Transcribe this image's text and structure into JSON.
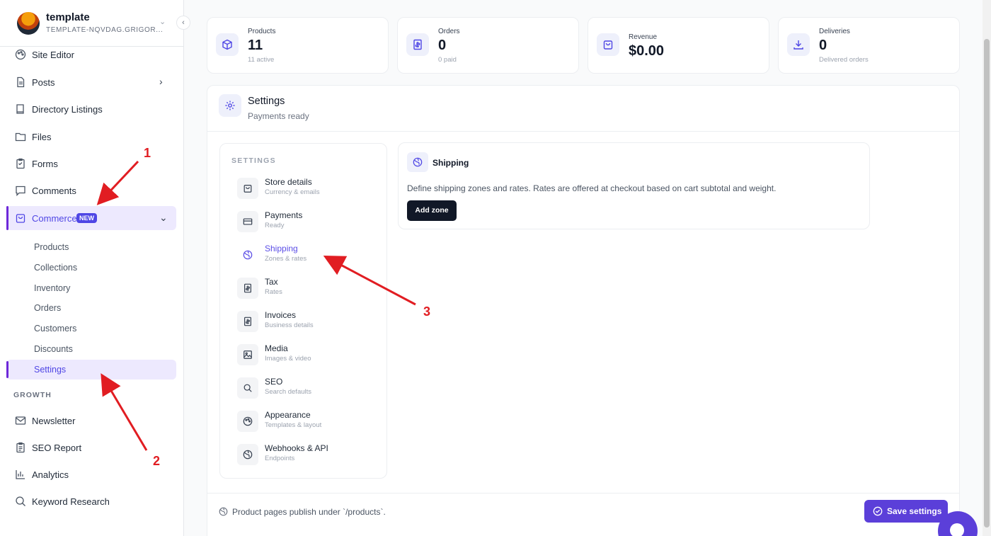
{
  "workspace": {
    "name": "template",
    "subtitle": "TEMPLATE-NQVDAG.GRIGOR..."
  },
  "sidebar": {
    "items": [
      {
        "label": "Site Editor",
        "icon": "palette-icon"
      },
      {
        "label": "Posts",
        "icon": "document-icon"
      },
      {
        "label": "Directory Listings",
        "icon": "book-icon"
      },
      {
        "label": "Files",
        "icon": "folder-icon"
      },
      {
        "label": "Forms",
        "icon": "clipboard-icon"
      },
      {
        "label": "Comments",
        "icon": "comment-icon"
      },
      {
        "label": "Commerce",
        "icon": "shopping-bag-icon",
        "badge": "NEW"
      }
    ],
    "commerce_sub": [
      "Products",
      "Collections",
      "Inventory",
      "Orders",
      "Customers",
      "Discounts",
      "Settings"
    ],
    "growth_label": "GROWTH",
    "growth_items": [
      {
        "label": "Newsletter",
        "icon": "mail-icon"
      },
      {
        "label": "SEO Report",
        "icon": "clipboard-check-icon"
      },
      {
        "label": "Analytics",
        "icon": "bar-chart-icon"
      },
      {
        "label": "Keyword Research",
        "icon": "search-icon"
      }
    ]
  },
  "stats": [
    {
      "title": "Products",
      "value": "11",
      "sub": "11 active",
      "icon": "box-icon"
    },
    {
      "title": "Orders",
      "value": "0",
      "sub": "0 paid",
      "icon": "receipt-icon"
    },
    {
      "title": "Revenue",
      "value": "$0.00",
      "sub": "",
      "icon": "bag-icon"
    },
    {
      "title": "Deliveries",
      "value": "0",
      "sub": "Delivered orders",
      "icon": "download-icon"
    }
  ],
  "panel": {
    "title": "Settings",
    "subtitle": "Payments ready",
    "nav_heading": "SETTINGS",
    "nav": [
      {
        "title": "Store details",
        "sub": "Currency & emails"
      },
      {
        "title": "Payments",
        "sub": "Ready"
      },
      {
        "title": "Shipping",
        "sub": "Zones & rates"
      },
      {
        "title": "Tax",
        "sub": "Rates"
      },
      {
        "title": "Invoices",
        "sub": "Business details"
      },
      {
        "title": "Media",
        "sub": "Images & video"
      },
      {
        "title": "SEO",
        "sub": "Search defaults"
      },
      {
        "title": "Appearance",
        "sub": "Templates & layout"
      },
      {
        "title": "Webhooks & API",
        "sub": "Endpoints"
      }
    ],
    "shipping": {
      "title": "Shipping",
      "description": "Define shipping zones and rates. Rates are offered at checkout based on cart subtotal and weight.",
      "button": "Add zone"
    },
    "footer_note": "Product pages publish under `/products`.",
    "save_label": "Save settings"
  },
  "annotations": [
    "1",
    "2",
    "3"
  ],
  "colors": {
    "accent": "#5b3fd9",
    "annotation": "#e11d22",
    "active_bg": "#ede9fe"
  }
}
